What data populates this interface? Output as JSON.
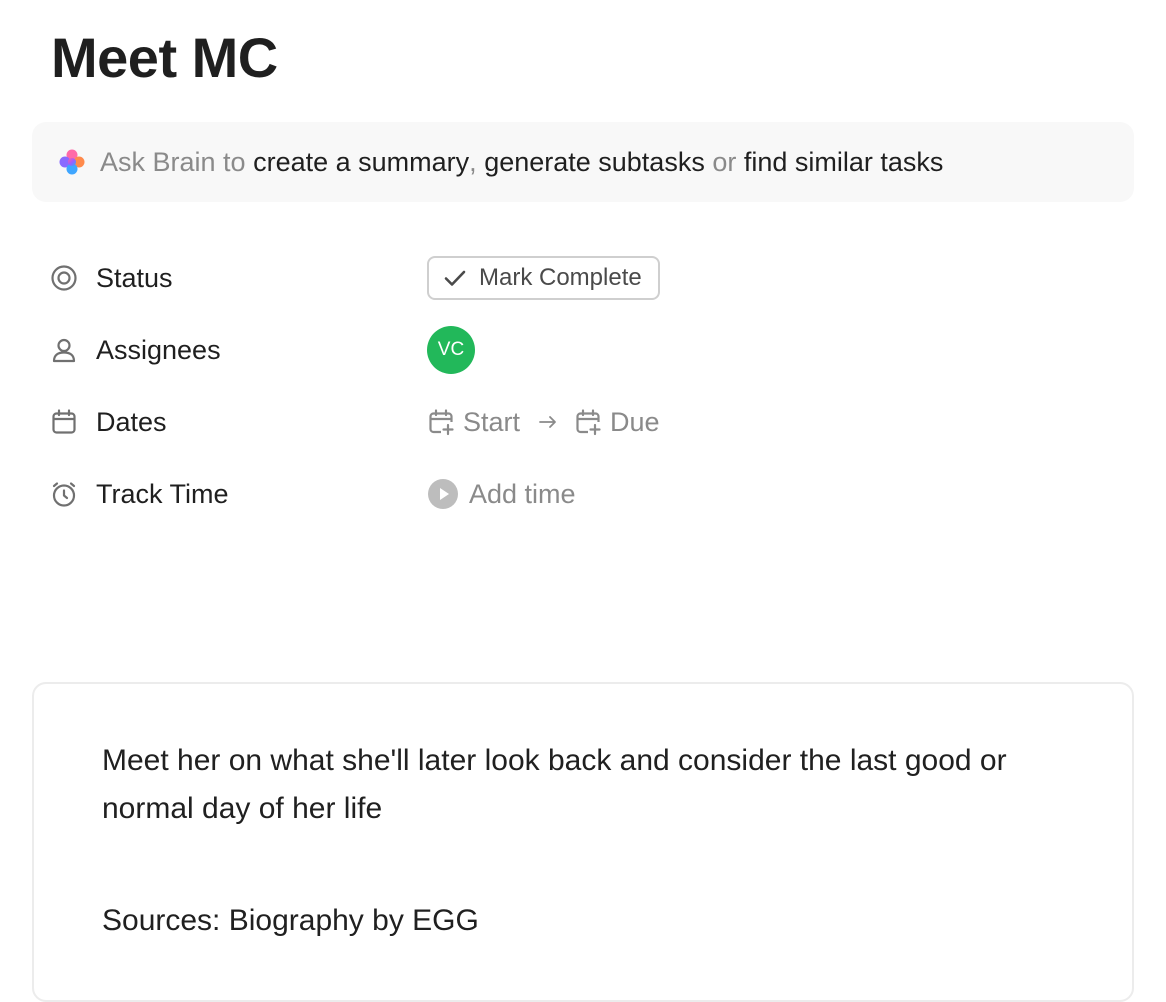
{
  "task": {
    "title": "Meet MC"
  },
  "brain_bar": {
    "icon": "brain-sparkle-icon",
    "prefix": "Ask Brain to",
    "action_1": "create a summary",
    "separator_1": ",",
    "action_2": "generate subtasks",
    "separator_2": "or",
    "action_3": "find similar tasks"
  },
  "fields": {
    "status": {
      "icon": "status-target-icon",
      "label": "Status",
      "button_label": "Mark Complete"
    },
    "assignees": {
      "icon": "person-icon",
      "label": "Assignees",
      "avatar_initials": "VC",
      "avatar_color": "#22b85a"
    },
    "dates": {
      "icon": "calendar-icon",
      "label": "Dates",
      "start_label": "Start",
      "due_label": "Due"
    },
    "track_time": {
      "icon": "stopwatch-icon",
      "label": "Track Time",
      "add_label": "Add time"
    }
  },
  "description": {
    "text": "Meet her on what she'll later look back and consider the last good or normal day of her life",
    "sources": "Sources: Biography by EGG"
  }
}
